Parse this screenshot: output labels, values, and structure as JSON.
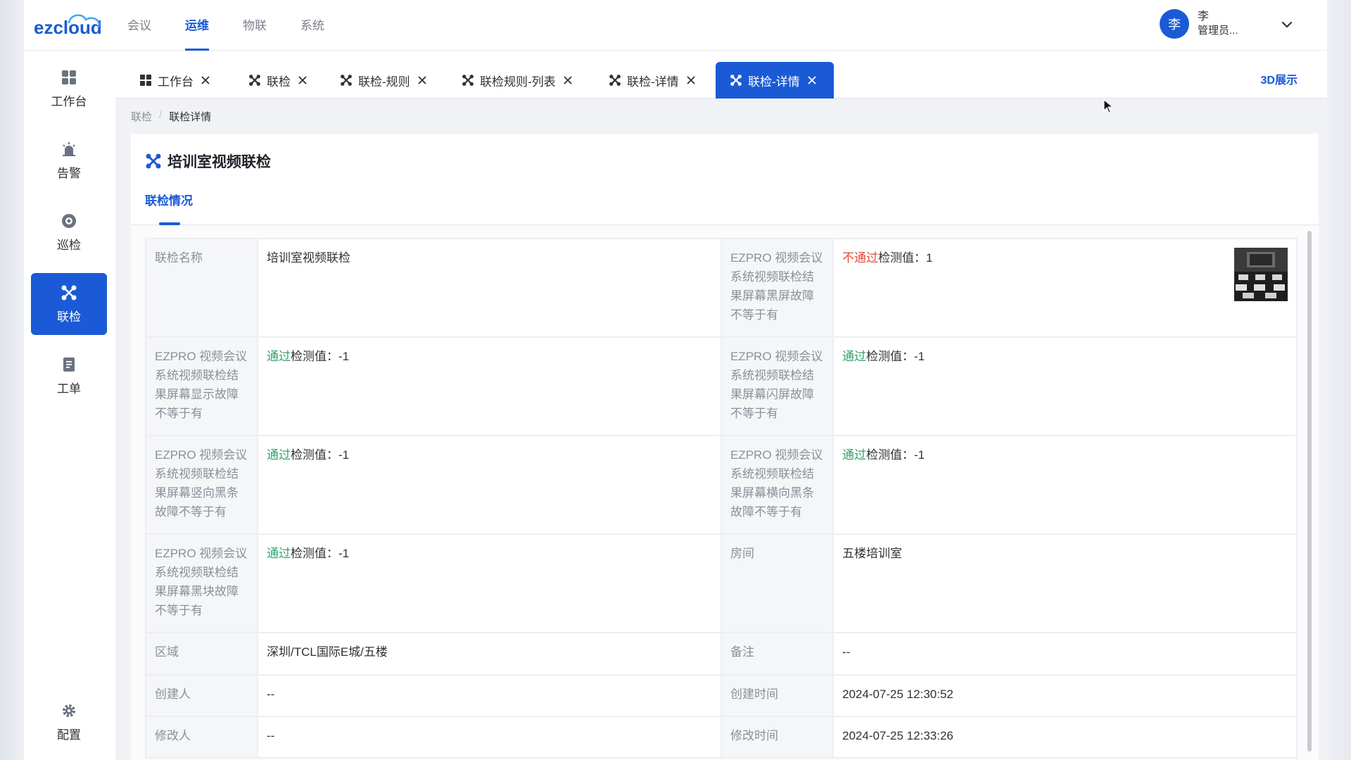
{
  "header": {
    "logo_text": "ezcloud",
    "nav": [
      {
        "label": "会议",
        "active": false
      },
      {
        "label": "运维",
        "active": true
      },
      {
        "label": "物联",
        "active": false
      },
      {
        "label": "系统",
        "active": false
      }
    ],
    "user": {
      "avatar": "李",
      "name": "李",
      "role": "管理员..."
    }
  },
  "sidebar": {
    "items": [
      {
        "label": "工作台",
        "icon": "grid-icon"
      },
      {
        "label": "告警",
        "icon": "alarm-icon"
      },
      {
        "label": "巡检",
        "icon": "patrol-icon"
      },
      {
        "label": "联检",
        "icon": "linkage-icon",
        "active": true
      },
      {
        "label": "工单",
        "icon": "workorder-icon"
      },
      {
        "label": "配置",
        "icon": "gear-icon"
      }
    ]
  },
  "tabs": [
    {
      "label": "工作台"
    },
    {
      "label": "联检"
    },
    {
      "label": "联检-规则"
    },
    {
      "label": "联检规则-列表"
    },
    {
      "label": "联检-详情"
    },
    {
      "label": "联检-详情",
      "active": true
    }
  ],
  "action_3d": "3D展示",
  "breadcrumb": {
    "parent": "联检",
    "sep": "/",
    "current": "联检详情"
  },
  "detail": {
    "title": "培训室视频联检",
    "tab": "联检情况",
    "rows": [
      {
        "l1": "联检名称",
        "v1": "培训室视频联检",
        "l2": "EZPRO 视频会议系统视频联检结果屏幕黑屏故障不等于有",
        "v2_status": "不通过",
        "v2_rest": "检测值：1"
      },
      {
        "l1": "EZPRO 视频会议系统视频联检结果屏幕显示故障不等于有",
        "v1_status": "通过",
        "v1_rest": "检测值：-1",
        "l2": "EZPRO 视频会议系统视频联检结果屏幕闪屏故障不等于有",
        "v2_status": "通过",
        "v2_rest": "检测值：-1"
      },
      {
        "l1": "EZPRO 视频会议系统视频联检结果屏幕竖向黑条故障不等于有",
        "v1_status": "通过",
        "v1_rest": "检测值：-1",
        "l2": "EZPRO 视频会议系统视频联检结果屏幕横向黑条故障不等于有",
        "v2_status": "通过",
        "v2_rest": "检测值：-1"
      },
      {
        "l1": "EZPRO 视频会议系统视频联检结果屏幕黑块故障不等于有",
        "v1_status": "通过",
        "v1_rest": "检测值：-1",
        "l2": "房间",
        "v2": "五楼培训室"
      },
      {
        "l1": "区域",
        "v1": "深圳/TCL国际E城/五楼",
        "l2": "备注",
        "v2": "--"
      },
      {
        "l1": "创建人",
        "v1": "--",
        "l2": "创建时间",
        "v2": "2024-07-25 12:30:52"
      },
      {
        "l1": "修改人",
        "v1": "--",
        "l2": "修改时间",
        "v2": "2024-07-25 12:33:26"
      }
    ]
  },
  "colors": {
    "primary": "#1a5ad6",
    "pass": "#2ea36a",
    "fail": "#e34a36"
  }
}
